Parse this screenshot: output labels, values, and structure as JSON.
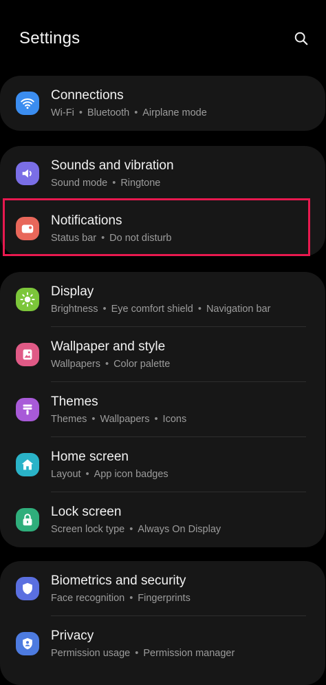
{
  "header": {
    "title": "Settings",
    "search_icon": "search-icon"
  },
  "groups": [
    {
      "items": [
        {
          "id": "connections",
          "label": "Connections",
          "subs": [
            "Wi-Fi",
            "Bluetooth",
            "Airplane mode"
          ],
          "icon": "wifi-icon",
          "color": "#3b8df0"
        }
      ]
    },
    {
      "items": [
        {
          "id": "sounds",
          "label": "Sounds and vibration",
          "subs": [
            "Sound mode",
            "Ringtone"
          ],
          "icon": "speaker-icon",
          "color": "#7a6ee6"
        },
        {
          "id": "notifications",
          "label": "Notifications",
          "subs": [
            "Status bar",
            "Do not disturb"
          ],
          "icon": "notification-icon",
          "color": "#e8675a"
        }
      ]
    },
    {
      "items": [
        {
          "id": "display",
          "label": "Display",
          "subs": [
            "Brightness",
            "Eye comfort shield",
            "Navigation bar"
          ],
          "icon": "sun-icon",
          "color": "#7cc63a"
        },
        {
          "id": "wallpaper",
          "label": "Wallpaper and style",
          "subs": [
            "Wallpapers",
            "Color palette"
          ],
          "icon": "image-icon",
          "color": "#e05a86"
        },
        {
          "id": "themes",
          "label": "Themes",
          "subs": [
            "Themes",
            "Wallpapers",
            "Icons"
          ],
          "icon": "paint-brush-icon",
          "color": "#a85ad8"
        },
        {
          "id": "home",
          "label": "Home screen",
          "subs": [
            "Layout",
            "App icon badges"
          ],
          "icon": "home-icon",
          "color": "#2ab3c8"
        },
        {
          "id": "lock",
          "label": "Lock screen",
          "subs": [
            "Screen lock type",
            "Always On Display"
          ],
          "icon": "lock-icon",
          "color": "#2fae7b"
        }
      ]
    },
    {
      "items": [
        {
          "id": "biometrics",
          "label": "Biometrics and security",
          "subs": [
            "Face recognition",
            "Fingerprints"
          ],
          "icon": "shield-icon",
          "color": "#5a6fe0"
        },
        {
          "id": "privacy",
          "label": "Privacy",
          "subs": [
            "Permission usage",
            "Permission manager"
          ],
          "icon": "privacy-icon",
          "color": "#4d7be0"
        }
      ]
    }
  ],
  "highlight_color": "#e8194f"
}
